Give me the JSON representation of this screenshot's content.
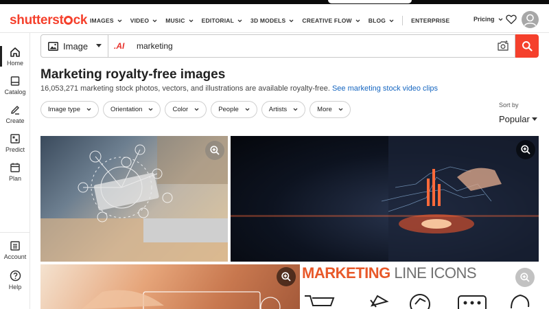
{
  "brand": {
    "logo_text_pre": "shutterst",
    "logo_text_post": "ck",
    "accent": "#f5402c"
  },
  "nav": {
    "items": [
      {
        "label": "IMAGES",
        "dropdown": true
      },
      {
        "label": "VIDEO",
        "dropdown": true
      },
      {
        "label": "MUSIC",
        "dropdown": true
      },
      {
        "label": "EDITORIAL",
        "dropdown": true
      },
      {
        "label": "3D MODELS",
        "dropdown": true
      },
      {
        "label": "CREATIVE FLOW",
        "dropdown": true
      },
      {
        "label": "BLOG",
        "dropdown": true
      },
      {
        "label": "ENTERPRISE",
        "dropdown": false
      }
    ],
    "pricing_label": "Pricing",
    "icons": [
      "chevron-down-icon",
      "heart-icon",
      "user-avatar-icon"
    ]
  },
  "sidebar": {
    "items": [
      {
        "label": "Home",
        "icon": "home-icon",
        "active": true
      },
      {
        "label": "Catalog",
        "icon": "catalog-icon"
      },
      {
        "label": "Create",
        "icon": "create-icon"
      },
      {
        "label": "Predict",
        "icon": "predict-icon"
      },
      {
        "label": "Plan",
        "icon": "calendar-icon"
      },
      {
        "label": "Account",
        "icon": "account-icon"
      },
      {
        "label": "Help",
        "icon": "help-icon"
      }
    ]
  },
  "search": {
    "type_label": "Image",
    "ai_mark": ".AI",
    "query": "marketing",
    "icons": [
      "image-icon",
      "camera-search-icon",
      "search-icon"
    ]
  },
  "results": {
    "title": "Marketing royalty-free images",
    "subtitle": "16,053,271 marketing stock photos, vectors, and illustrations are available royalty-free.",
    "video_link": "See marketing stock video clips"
  },
  "filters": [
    "Image type",
    "Orientation",
    "Color",
    "People",
    "Artists",
    "More"
  ],
  "sort": {
    "label": "Sort by",
    "value": "Popular"
  },
  "images": {
    "icons_tile": {
      "title_a": "MARKETING",
      "title_b": "LINE ICONS"
    }
  }
}
